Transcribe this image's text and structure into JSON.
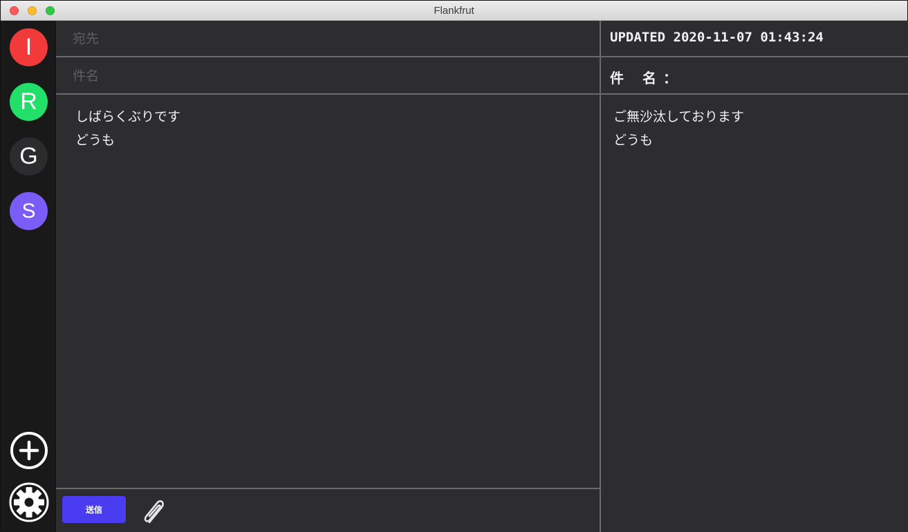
{
  "window": {
    "title": "Flankfrut"
  },
  "sidebar": {
    "accounts": [
      {
        "letter": "I",
        "color": "#f23a3a"
      },
      {
        "letter": "R",
        "color": "#22df6a"
      },
      {
        "letter": "G",
        "color": "#2c2c2e"
      },
      {
        "letter": "S",
        "color": "#7a5cf6"
      }
    ],
    "add_icon": "plus-circle-icon",
    "settings_icon": "gear-icon"
  },
  "compose": {
    "to_placeholder": "宛先",
    "subject_placeholder": "件名",
    "body": "しばらくぶりです\nどうも",
    "send_label": "送信",
    "attach_icon": "paperclip-icon",
    "send_color": "#4a3cf0"
  },
  "preview": {
    "updated": "UPDATED 2020-11-07 01:43:24",
    "subject_label": "件 名：",
    "body": "ご無沙汰しております\nどうも"
  }
}
